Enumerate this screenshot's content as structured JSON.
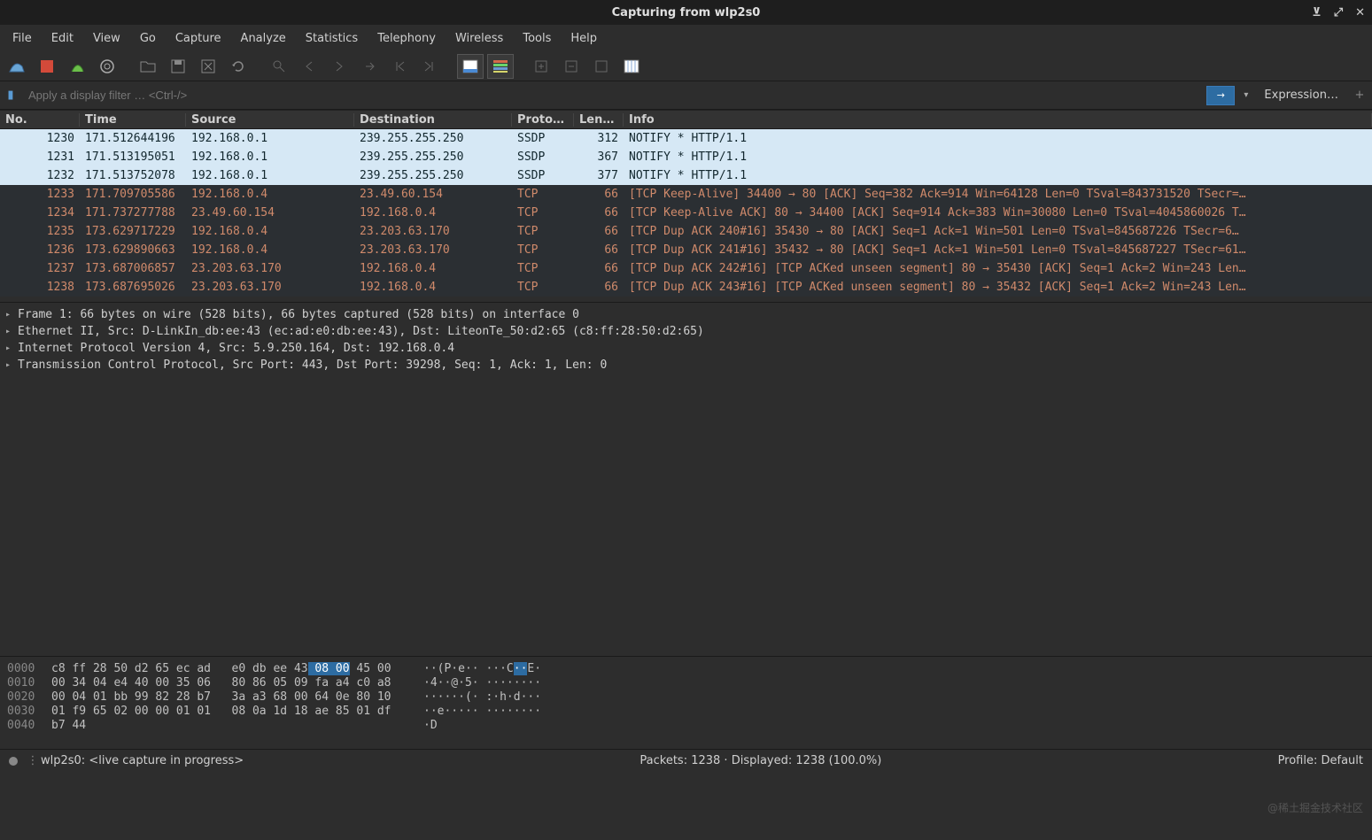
{
  "window": {
    "title": "Capturing from wlp2s0"
  },
  "menu": [
    "File",
    "Edit",
    "View",
    "Go",
    "Capture",
    "Analyze",
    "Statistics",
    "Telephony",
    "Wireless",
    "Tools",
    "Help"
  ],
  "filter": {
    "placeholder": "Apply a display filter … <Ctrl-/>",
    "expression": "Expression…"
  },
  "columns": {
    "no": "No.",
    "time": "Time",
    "src": "Source",
    "dst": "Destination",
    "proto": "Protocol",
    "len": "Length",
    "info": "Info"
  },
  "packets": [
    {
      "no": "1230",
      "time": "171.512644196",
      "src": "192.168.0.1",
      "dst": "239.255.255.250",
      "proto": "SSDP",
      "len": "312",
      "info": "NOTIFY * HTTP/1.1",
      "cls": "ssdp"
    },
    {
      "no": "1231",
      "time": "171.513195051",
      "src": "192.168.0.1",
      "dst": "239.255.255.250",
      "proto": "SSDP",
      "len": "367",
      "info": "NOTIFY * HTTP/1.1",
      "cls": "ssdp"
    },
    {
      "no": "1232",
      "time": "171.513752078",
      "src": "192.168.0.1",
      "dst": "239.255.255.250",
      "proto": "SSDP",
      "len": "377",
      "info": "NOTIFY * HTTP/1.1",
      "cls": "ssdp"
    },
    {
      "no": "1233",
      "time": "171.709705586",
      "src": "192.168.0.4",
      "dst": "23.49.60.154",
      "proto": "TCP",
      "len": "66",
      "info": "[TCP Keep-Alive] 34400 → 80 [ACK] Seq=382 Ack=914 Win=64128 Len=0 TSval=843731520 TSecr=…",
      "cls": "tcp"
    },
    {
      "no": "1234",
      "time": "171.737277788",
      "src": "23.49.60.154",
      "dst": "192.168.0.4",
      "proto": "TCP",
      "len": "66",
      "info": "[TCP Keep-Alive ACK] 80 → 34400 [ACK] Seq=914 Ack=383 Win=30080 Len=0 TSval=4045860026 T…",
      "cls": "tcp"
    },
    {
      "no": "1235",
      "time": "173.629717229",
      "src": "192.168.0.4",
      "dst": "23.203.63.170",
      "proto": "TCP",
      "len": "66",
      "info": "[TCP Dup ACK 240#16] 35430 → 80 [ACK] Seq=1 Ack=1 Win=501 Len=0 TSval=845687226 TSecr=6…",
      "cls": "tcp"
    },
    {
      "no": "1236",
      "time": "173.629890663",
      "src": "192.168.0.4",
      "dst": "23.203.63.170",
      "proto": "TCP",
      "len": "66",
      "info": "[TCP Dup ACK 241#16] 35432 → 80 [ACK] Seq=1 Ack=1 Win=501 Len=0 TSval=845687227 TSecr=61…",
      "cls": "tcp"
    },
    {
      "no": "1237",
      "time": "173.687006857",
      "src": "23.203.63.170",
      "dst": "192.168.0.4",
      "proto": "TCP",
      "len": "66",
      "info": "[TCP Dup ACK 242#16] [TCP ACKed unseen segment] 80 → 35430 [ACK] Seq=1 Ack=2 Win=243 Len…",
      "cls": "tcp"
    },
    {
      "no": "1238",
      "time": "173.687695026",
      "src": "23.203.63.170",
      "dst": "192.168.0.4",
      "proto": "TCP",
      "len": "66",
      "info": "[TCP Dup ACK 243#16] [TCP ACKed unseen segment] 80 → 35432 [ACK] Seq=1 Ack=2 Win=243 Len…",
      "cls": "tcp"
    }
  ],
  "details": [
    "Frame 1: 66 bytes on wire (528 bits), 66 bytes captured (528 bits) on interface 0",
    "Ethernet II, Src: D-LinkIn_db:ee:43 (ec:ad:e0:db:ee:43), Dst: LiteonTe_50:d2:65 (c8:ff:28:50:d2:65)",
    "Internet Protocol Version 4, Src: 5.9.250.164, Dst: 192.168.0.4",
    "Transmission Control Protocol, Src Port: 443, Dst Port: 39298, Seq: 1, Ack: 1, Len: 0"
  ],
  "bytes": {
    "rows": [
      {
        "off": "0000",
        "hex_a": "c8 ff 28 50 d2 65 ec ad",
        "hex_b": " e0 db ee 43",
        "hex_hl": " 08 00",
        "hex_c": " 45 00",
        "asc_a": "··(P·e·· ···C",
        "asc_hl": "··",
        "asc_b": "E·"
      },
      {
        "off": "0010",
        "hex_a": "00 34 04 e4 40 00 35 06",
        "hex_b": " 80 86 05 09 fa a4 c0 a8",
        "hex_hl": "",
        "hex_c": "",
        "asc_a": "·4··@·5· ········",
        "asc_hl": "",
        "asc_b": ""
      },
      {
        "off": "0020",
        "hex_a": "00 04 01 bb 99 82 28 b7",
        "hex_b": " 3a a3 68 00 64 0e 80 10",
        "hex_hl": "",
        "hex_c": "",
        "asc_a": "······(· :·h·d···",
        "asc_hl": "",
        "asc_b": ""
      },
      {
        "off": "0030",
        "hex_a": "01 f9 65 02 00 00 01 01",
        "hex_b": " 08 0a 1d 18 ae 85 01 df",
        "hex_hl": "",
        "hex_c": "",
        "asc_a": "··e····· ········",
        "asc_hl": "",
        "asc_b": ""
      },
      {
        "off": "0040",
        "hex_a": "b7 44",
        "hex_b": "",
        "hex_hl": "",
        "hex_c": "",
        "asc_a": "·D",
        "asc_hl": "",
        "asc_b": ""
      }
    ]
  },
  "status": {
    "left": "wlp2s0: <live capture in progress>",
    "center": "Packets: 1238 · Displayed: 1238 (100.0%)",
    "right": "Profile: Default"
  },
  "watermark": "@稀土掘金技术社区"
}
